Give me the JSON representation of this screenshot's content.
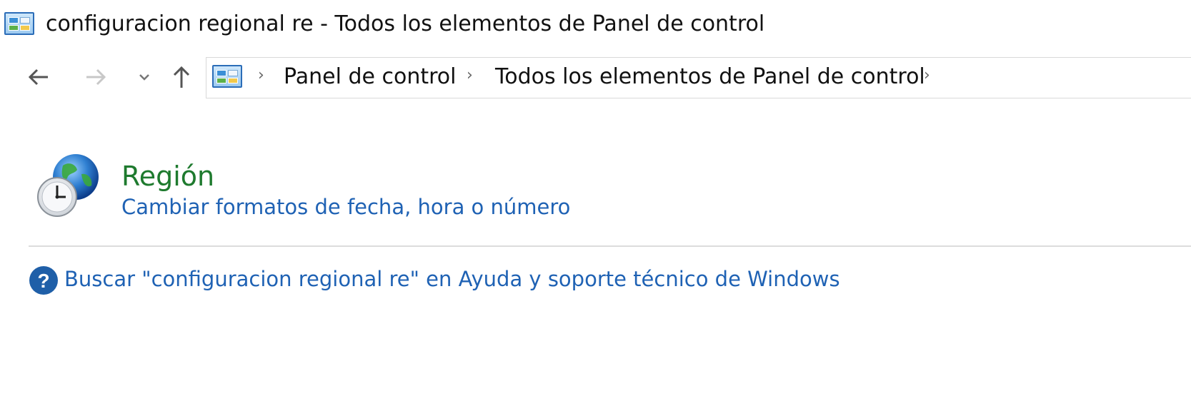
{
  "window": {
    "title": "configuracion regional re - Todos los elementos de Panel de control",
    "icon": "control-panel-icon"
  },
  "navigation": {
    "back_icon": "arrow-left-icon",
    "forward_icon": "arrow-right-icon",
    "recent_icon": "chevron-down-icon",
    "up_icon": "arrow-up-icon"
  },
  "address_bar": {
    "icon": "control-panel-icon",
    "breadcrumbs": [
      "Panel de control",
      "Todos los elementos de Panel de control"
    ]
  },
  "results": [
    {
      "icon": "region-globe-clock-icon",
      "title": "Región",
      "link": "Cambiar formatos de fecha, hora o número"
    }
  ],
  "help": {
    "icon": "help-icon",
    "link": "Buscar \"configuracion regional re\" en Ayuda y soporte técnico de Windows"
  },
  "colors": {
    "title_green": "#1e7a2e",
    "link_blue": "#1f62b4",
    "help_blue": "#1f5fa8"
  }
}
